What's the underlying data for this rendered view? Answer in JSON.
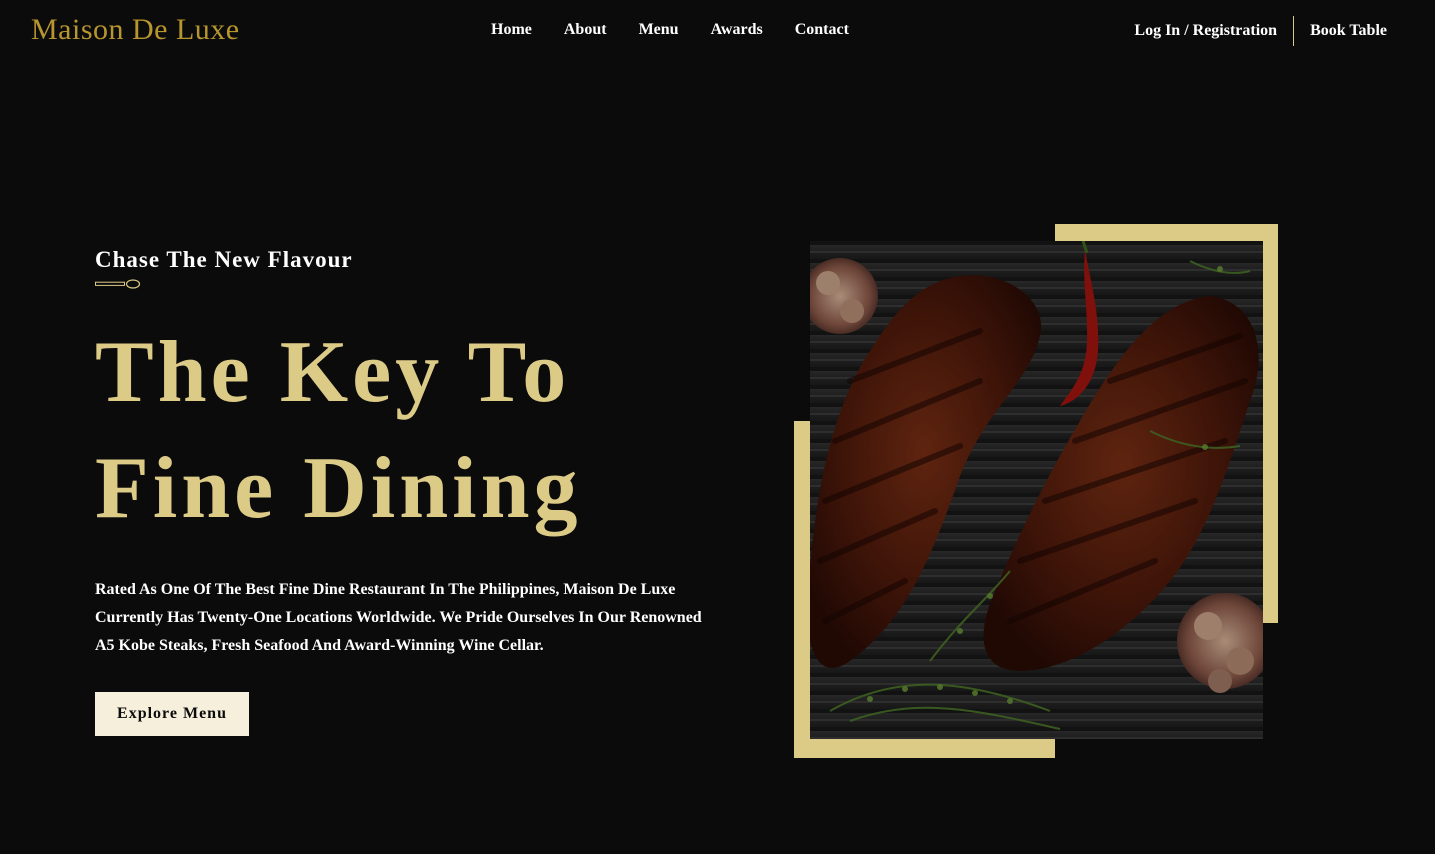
{
  "nav": {
    "logo": "Maison De Luxe",
    "links": [
      "Home",
      "About",
      "Menu",
      "Awards",
      "Contact"
    ],
    "login": "Log In / Registration",
    "book": "Book Table"
  },
  "hero": {
    "subtitle": "Chase The New Flavour",
    "headline_line1": "The Key To",
    "headline_line2": "Fine Dining",
    "description": "Rated As One Of The Best Fine Dine Restaurant In The Philippines, Maison De Luxe Currently Has Twenty-One Locations Worldwide. We Pride Ourselves In Our Renowned A5 Kobe Steaks, Fresh Seafood And Award-Winning Wine Cellar.",
    "button": "Explore Menu"
  },
  "colors": {
    "background": "#0b0b0b",
    "gold": "#dcca87",
    "logo_gold": "#b8962e",
    "button_bg": "#f5efdb"
  },
  "icons": {
    "spoon": "spoon-icon"
  }
}
